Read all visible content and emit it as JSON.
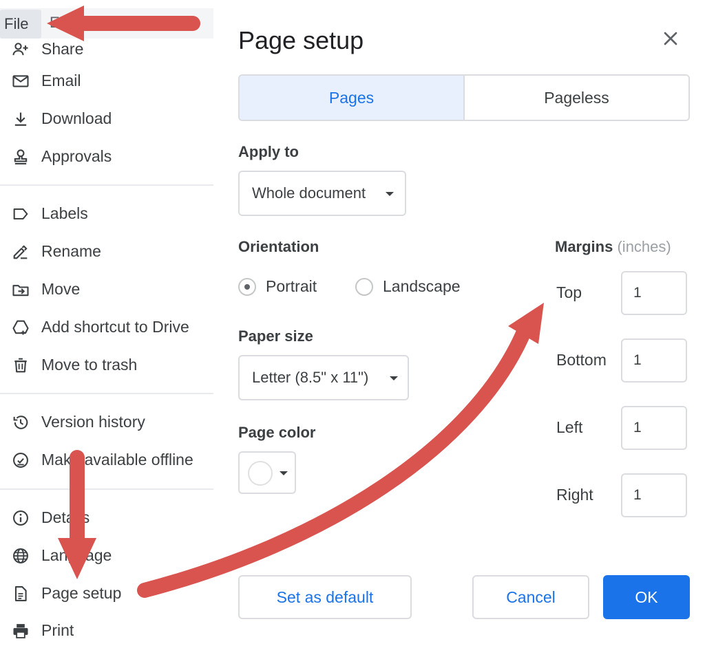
{
  "file_menu": {
    "file_tab": "File",
    "hidden_tab": "Edit",
    "items": [
      {
        "label": "Share",
        "icon": "share-icon"
      },
      {
        "label": "Email",
        "icon": "email-icon"
      },
      {
        "label": "Download",
        "icon": "download-icon"
      },
      {
        "label": "Approvals",
        "icon": "approvals-icon"
      },
      {
        "label": "Labels",
        "icon": "label-icon"
      },
      {
        "label": "Rename",
        "icon": "rename-icon"
      },
      {
        "label": "Move",
        "icon": "move-icon"
      },
      {
        "label": "Add shortcut to Drive",
        "icon": "add-shortcut-icon"
      },
      {
        "label": "Move to trash",
        "icon": "trash-icon"
      },
      {
        "label": "Version history",
        "icon": "history-icon"
      },
      {
        "label": "Make available offline",
        "icon": "offline-icon"
      },
      {
        "label": "Details",
        "icon": "info-icon"
      },
      {
        "label": "Language",
        "icon": "globe-icon"
      },
      {
        "label": "Page setup",
        "icon": "page-setup-icon"
      },
      {
        "label": "Print",
        "icon": "print-icon"
      }
    ]
  },
  "dialog": {
    "title": "Page setup",
    "tabs": {
      "pages": "Pages",
      "pageless": "Pageless",
      "active": "pages"
    },
    "apply_to": {
      "label": "Apply to",
      "value": "Whole document"
    },
    "orientation": {
      "label": "Orientation",
      "portrait": "Portrait",
      "landscape": "Landscape",
      "selected": "portrait"
    },
    "paper_size": {
      "label": "Paper size",
      "value": "Letter (8.5\" x 11\")"
    },
    "page_color": {
      "label": "Page color",
      "value": "#ffffff"
    },
    "margins": {
      "label": "Margins",
      "unit": "(inches)",
      "top": {
        "label": "Top",
        "value": "1"
      },
      "bottom": {
        "label": "Bottom",
        "value": "1"
      },
      "left": {
        "label": "Left",
        "value": "1"
      },
      "right": {
        "label": "Right",
        "value": "1"
      }
    },
    "buttons": {
      "set_default": "Set as default",
      "cancel": "Cancel",
      "ok": "OK"
    }
  },
  "colors": {
    "accent": "#1a73e8",
    "tab_active_bg": "#e8f0fe",
    "annotation_arrow": "#d9534f"
  }
}
